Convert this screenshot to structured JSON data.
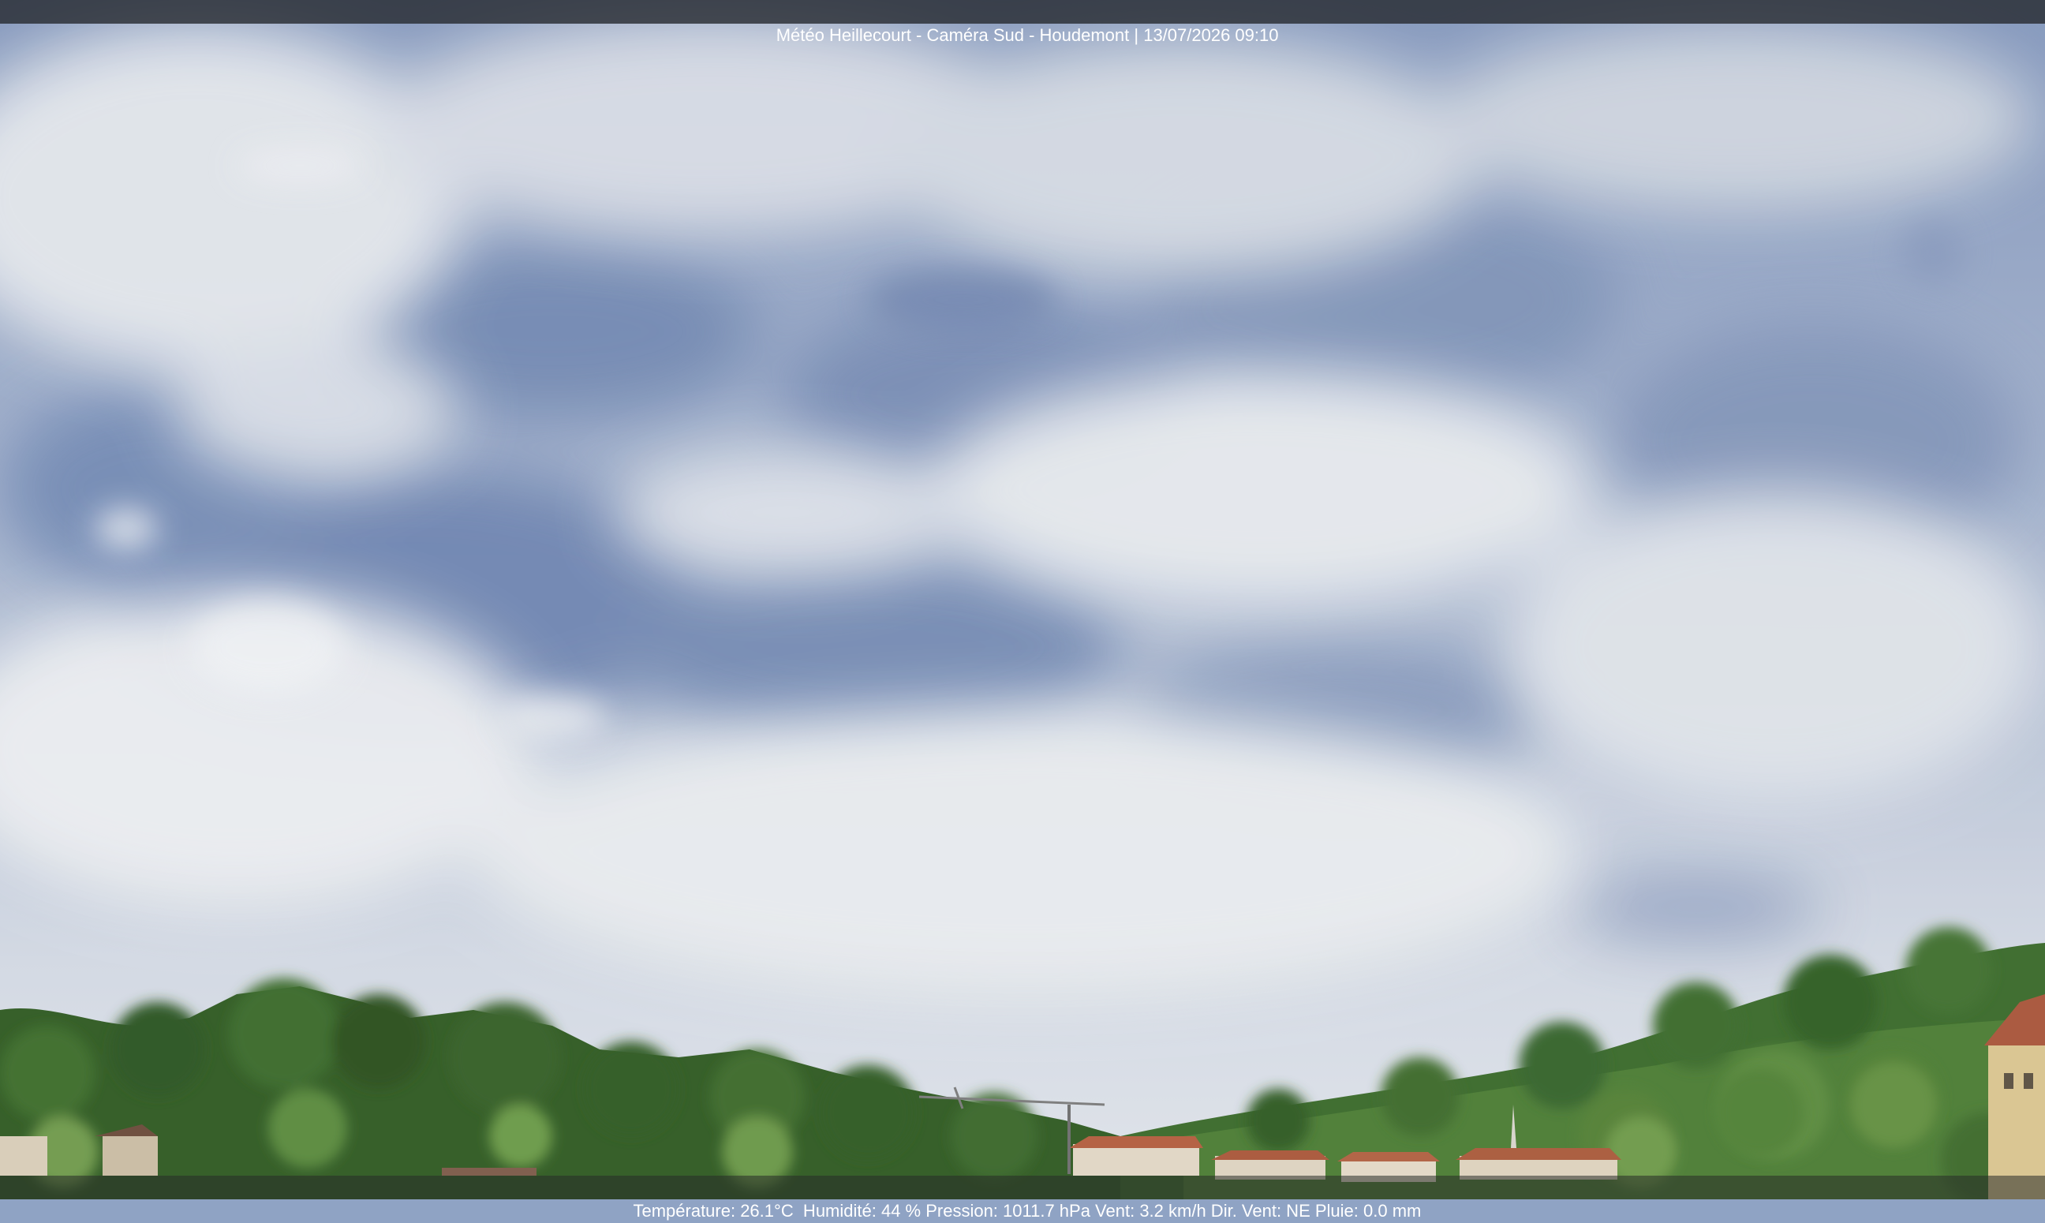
{
  "header": {
    "caption": "Météo Heillecourt - Caméra Sud - Houdemont | 13/07/2026 09:10"
  },
  "footer": {
    "caption": "Température: 26.1°C  Humidité: 44 % Pression: 1011.7 hPa Vent: 3.2 km/h Dir. Vent: NE Pluie: 0.0 mm"
  },
  "colors": {
    "sky_blue": "#6f86b2",
    "cloud_white": "#e8ebf0",
    "trees_dark": "#2f5a22",
    "trees_light": "#5e8f3a",
    "roofs": "#a8553a"
  }
}
